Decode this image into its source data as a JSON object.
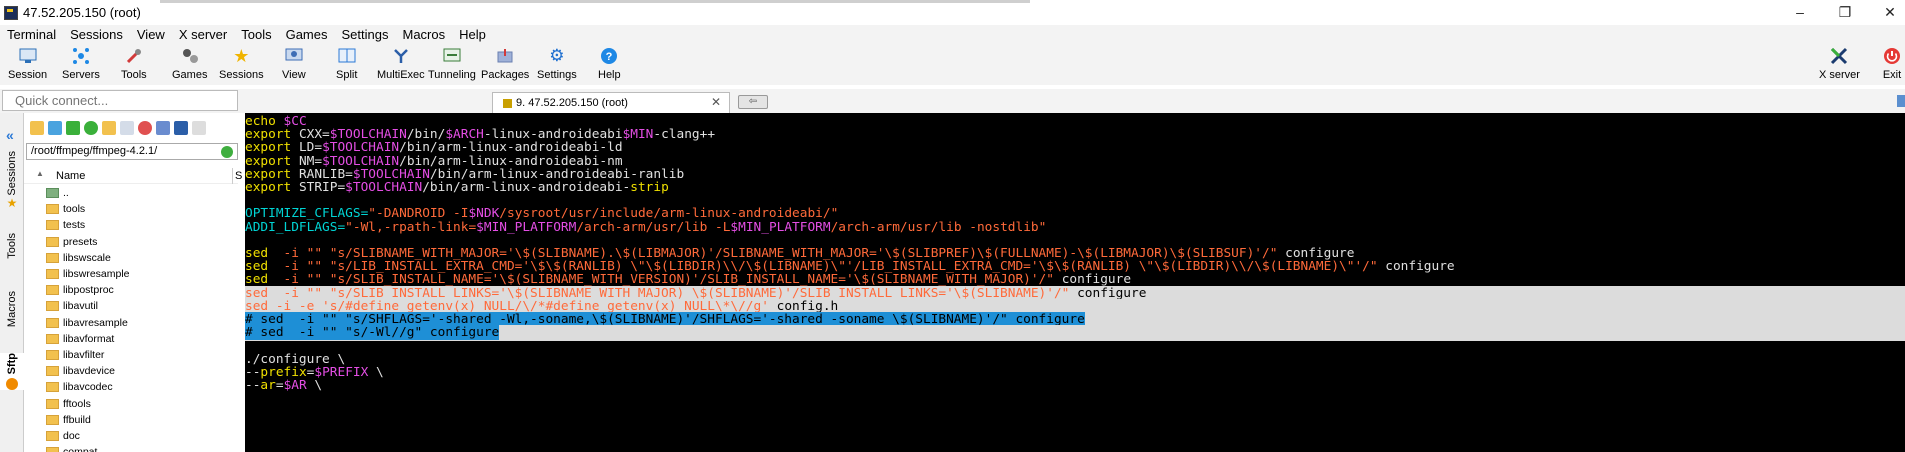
{
  "window": {
    "title": "47.52.205.150 (root)",
    "controls": [
      "–",
      "❐",
      "✕"
    ]
  },
  "menu": [
    "Terminal",
    "Sessions",
    "View",
    "X server",
    "Tools",
    "Games",
    "Settings",
    "Macros",
    "Help"
  ],
  "toolbar": [
    {
      "label": "Session",
      "icon": "session-icon",
      "color": "#2b6fb7"
    },
    {
      "label": "Servers",
      "icon": "servers-icon",
      "color": "#1e88e5"
    },
    {
      "label": "Tools",
      "icon": "tools-icon",
      "color": "#d23a3a"
    },
    {
      "label": "Games",
      "icon": "games-icon",
      "color": "#555555"
    },
    {
      "label": "Sessions",
      "icon": "star-icon",
      "color": "#f0b400"
    },
    {
      "label": "View",
      "icon": "view-icon",
      "color": "#3d6db5"
    },
    {
      "label": "Split",
      "icon": "split-icon",
      "color": "#2b79d6"
    },
    {
      "label": "MultiExec",
      "icon": "multiexec-icon",
      "color": "#2b5ea8"
    },
    {
      "label": "Tunneling",
      "icon": "tunneling-icon",
      "color": "#3a7d3a"
    },
    {
      "label": "Packages",
      "icon": "packages-icon",
      "color": "#6a7fb0"
    },
    {
      "label": "Settings",
      "icon": "settings-icon",
      "color": "#1e6fd0"
    },
    {
      "label": "Help",
      "icon": "help-icon",
      "color": "#1e88e5"
    }
  ],
  "toolbar_right": [
    {
      "label": "X server",
      "icon": "x-server-icon"
    },
    {
      "label": "Exit",
      "icon": "exit-icon"
    }
  ],
  "quick_connect": {
    "placeholder": "Quick connect..."
  },
  "session_tab": {
    "label": "9. 47.52.205.150 (root)"
  },
  "side_tabs": [
    "Sessions",
    "Tools",
    "Macros",
    "Sftp"
  ],
  "sftp": {
    "path": "/root/ffmpeg/ffmpeg-4.2.1/",
    "column_name": "Name",
    "column_size": "S",
    "files": [
      "..",
      "tools",
      "tests",
      "presets",
      "libswscale",
      "libswresample",
      "libpostproc",
      "libavutil",
      "libavresample",
      "libavformat",
      "libavfilter",
      "libavdevice",
      "libavcodec",
      "fftools",
      "ffbuild",
      "doc",
      "compat"
    ]
  },
  "terminal": {
    "lines": [
      {
        "row": 0,
        "segs": [
          [
            "y",
            "echo "
          ],
          [
            "m",
            "$CC"
          ]
        ]
      },
      {
        "row": 1,
        "segs": [
          [
            "y",
            "export "
          ],
          [
            "w",
            "CXX="
          ],
          [
            "m",
            "$TOOLCHAIN"
          ],
          [
            "w",
            "/bin/"
          ],
          [
            "m",
            "$ARCH"
          ],
          [
            "w",
            "-linux-androideabi"
          ],
          [
            "m",
            "$MIN"
          ],
          [
            "w",
            "-clang++"
          ]
        ]
      },
      {
        "row": 2,
        "segs": [
          [
            "y",
            "export "
          ],
          [
            "w",
            "LD="
          ],
          [
            "m",
            "$TOOLCHAIN"
          ],
          [
            "w",
            "/bin/arm-linux-androideabi-ld"
          ]
        ]
      },
      {
        "row": 3,
        "segs": [
          [
            "y",
            "export "
          ],
          [
            "w",
            "NM="
          ],
          [
            "m",
            "$TOOLCHAIN"
          ],
          [
            "w",
            "/bin/arm-linux-androideabi-nm"
          ]
        ]
      },
      {
        "row": 4,
        "segs": [
          [
            "y",
            "export "
          ],
          [
            "w",
            "RANLIB="
          ],
          [
            "m",
            "$TOOLCHAIN"
          ],
          [
            "w",
            "/bin/arm-linux-androideabi-ranlib"
          ]
        ]
      },
      {
        "row": 5,
        "segs": [
          [
            "y",
            "export "
          ],
          [
            "w",
            "STRIP="
          ],
          [
            "m",
            "$TOOLCHAIN"
          ],
          [
            "w",
            "/bin/arm-linux-androideabi-"
          ],
          [
            "y",
            "strip"
          ]
        ]
      },
      {
        "row": 7,
        "segs": [
          [
            "c",
            "OPTIMIZE_CFLAGS="
          ],
          [
            "o",
            "\"-DANDROID -I"
          ],
          [
            "m",
            "$NDK"
          ],
          [
            "o",
            "/sysroot/usr/include/arm-linux-androideabi/\""
          ]
        ]
      },
      {
        "row": 8,
        "segs": [
          [
            "c",
            "ADDI_LDFLAGS="
          ],
          [
            "o",
            "\"-Wl,-rpath-link="
          ],
          [
            "m",
            "$MIN_PLATFORM"
          ],
          [
            "o",
            "/arch-arm/usr/lib -L"
          ],
          [
            "m",
            "$MIN_PLATFORM"
          ],
          [
            "o",
            "/arch-arm/usr/lib -nostdlib\""
          ]
        ]
      },
      {
        "row": 10,
        "segs": [
          [
            "y",
            "sed  "
          ],
          [
            "o",
            "-i \"\" \"s/SLIBNAME_WITH_MAJOR='\\$(SLIBNAME).\\$(LIBMAJOR)'/SLIBNAME_WITH_MAJOR='\\$(SLIBPREF)\\$(FULLNAME)-\\$(LIBMAJOR)\\$(SLIBSUF)'/\""
          ],
          [
            "w",
            " configure"
          ]
        ]
      },
      {
        "row": 11,
        "segs": [
          [
            "y",
            "sed  "
          ],
          [
            "o",
            "-i \"\" \"s/LIB_INSTALL_EXTRA_CMD='\\$\\$(RANLIB) \\\"\\$(LIBDIR)\\\\/\\$(LIBNAME)\\\"'/LIB_INSTALL_EXTRA_CMD='\\$\\$(RANLIB) \\\"\\$(LIBDIR)\\\\/\\$(LIBNAME)\\\"'/\""
          ],
          [
            "w",
            " configure"
          ]
        ]
      },
      {
        "row": 12,
        "segs": [
          [
            "y",
            "sed  "
          ],
          [
            "o",
            "-i \"\" \"s/SLIB_INSTALL_NAME='\\$(SLIBNAME_WITH_VERSION)'/SLIB_INSTALL_NAME='\\$(SLIBNAME_WITH_MAJOR)'/\""
          ],
          [
            "w",
            " configure"
          ]
        ]
      },
      {
        "row": 13,
        "bg": "light",
        "segs": [
          [
            "o",
            "sed  -i \"\" \"s/SLIB_INSTALL_LINKS='\\$(SLIBNAME_WITH_MAJOR) \\$(SLIBNAME)'/SLIB_INSTALL_LINKS='\\$(SLIBNAME)'/\""
          ],
          [
            "b",
            " configure"
          ]
        ]
      },
      {
        "row": 14,
        "bg": "light",
        "segs": [
          [
            "o",
            "sed -i -e 's/#define getenv(x) NULL/\\/*#define getenv(x) NULL\\*\\//g'"
          ],
          [
            "b",
            " config.h"
          ]
        ]
      },
      {
        "row": 15,
        "bg": "blue",
        "segs": [
          [
            "b",
            "# sed  -i \"\" \"s/SHFLAGS='-shared -Wl,-soname,\\$(SLIBNAME)'/SHFLAGS='-shared -soname \\$(SLIBNAME)'/\" configure"
          ]
        ]
      },
      {
        "row": 16,
        "bg": "blue",
        "segs": [
          [
            "b",
            "# sed  -i \"\" \"s/-Wl//g\" configure"
          ]
        ]
      },
      {
        "row": 18,
        "segs": [
          [
            "w",
            "./configure \\"
          ]
        ]
      },
      {
        "row": 19,
        "segs": [
          [
            "w",
            "--"
          ],
          [
            "y",
            "prefix"
          ],
          [
            "w",
            "="
          ],
          [
            "m",
            "$PREFIX"
          ],
          [
            "w",
            " \\"
          ]
        ]
      },
      {
        "row": 20,
        "segs": [
          [
            "w",
            "--"
          ],
          [
            "y",
            "ar"
          ],
          [
            "w",
            "="
          ],
          [
            "m",
            "$AR"
          ],
          [
            "w",
            " \\"
          ]
        ]
      }
    ]
  }
}
